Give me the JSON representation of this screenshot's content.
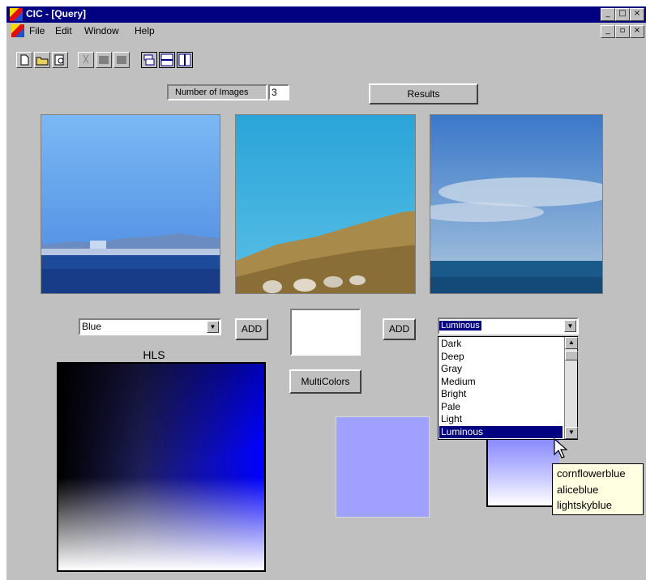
{
  "window": {
    "title": "CIC - [Query]",
    "controls": {
      "minimize": "_",
      "maximize": "□",
      "close": "×",
      "mdi_restore": "▫"
    }
  },
  "menu": {
    "items": [
      {
        "label": "File"
      },
      {
        "label": "Edit"
      },
      {
        "label": "Window"
      },
      {
        "label": "Help"
      }
    ]
  },
  "toolbar": {
    "icons": [
      "new-file-icon",
      "open-folder-icon",
      "print-preview-icon",
      "cut-icon",
      "copy-icon",
      "paste-icon",
      "cascade-icon",
      "tile-horizontal-icon",
      "tile-vertical-icon"
    ]
  },
  "query": {
    "num_images_label": "Number of Images",
    "num_images_value": "3",
    "results_label": "Results"
  },
  "images": [
    {
      "name": "coastal-city-under-blue-sky"
    },
    {
      "name": "hillside-with-sheep"
    },
    {
      "name": "sea-horizon-clouds"
    }
  ],
  "left_panel": {
    "color_select": "Blue",
    "add_label": "ADD",
    "hls_label": "HLS"
  },
  "center_panel": {
    "add_label": "ADD",
    "multicolors_label": "MultiColors",
    "swatch_color": "#a0a0ff"
  },
  "right_panel": {
    "intensity_select": "Luminous",
    "options": [
      "Dark",
      "Deep",
      "Gray",
      "Medium",
      "Bright",
      "Pale",
      "Light",
      "Luminous"
    ],
    "tooltip": [
      "cornflowerblue",
      "aliceblue",
      "lightskyblue"
    ]
  },
  "colors": {
    "titlebar": "#000080",
    "face": "#c0c0c0",
    "selected": "#000080"
  }
}
